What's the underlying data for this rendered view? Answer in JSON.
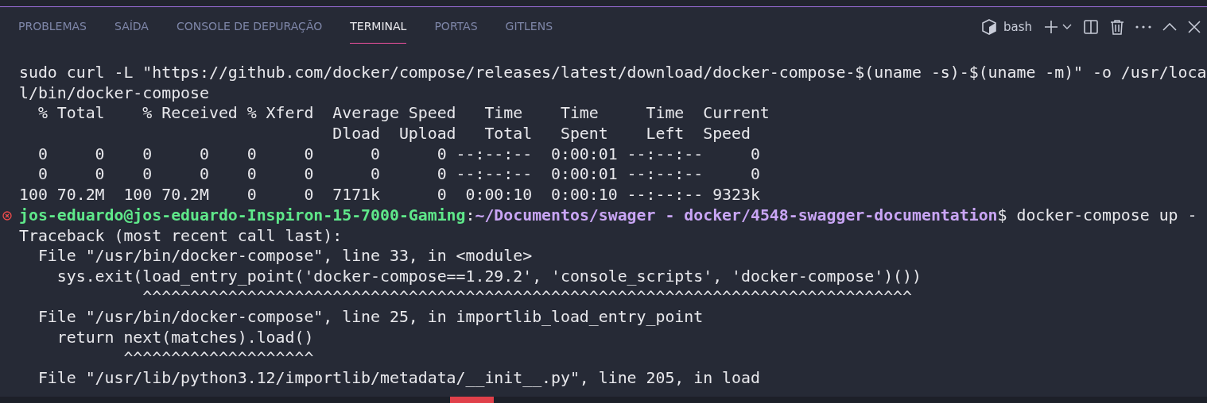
{
  "panel_tabs": [
    {
      "label": "PROBLEMAS",
      "selected": false
    },
    {
      "label": "SAÍDA",
      "selected": false
    },
    {
      "label": "CONSOLE DE DEPURAÇÃO",
      "selected": false
    },
    {
      "label": "TERMINAL",
      "selected": true
    },
    {
      "label": "PORTAS",
      "selected": false
    },
    {
      "label": "GITLENS",
      "selected": false
    }
  ],
  "terminal_profile": "bash",
  "terminal_lines": [
    {
      "kind": "text",
      "text": "sudo curl -L \"https://github.com/docker/compose/releases/latest/download/docker-compose-$(uname -s)-$(uname -m)\" -o /usr/loca"
    },
    {
      "kind": "text",
      "text": "l/bin/docker-compose"
    },
    {
      "kind": "text",
      "text": "  % Total    % Received % Xferd  Average Speed   Time    Time     Time  Current"
    },
    {
      "kind": "text",
      "text": "                                 Dload  Upload   Total   Spent    Left  Speed"
    },
    {
      "kind": "text",
      "text": "  0     0    0     0    0     0      0      0 --:--:--  0:00:01 --:--:--     0"
    },
    {
      "kind": "text",
      "text": "  0     0    0     0    0     0      0      0 --:--:--  0:00:01 --:--:--     0"
    },
    {
      "kind": "text",
      "text": "100 70.2M  100 70.2M    0     0  7171k      0  0:00:10  0:00:10 --:--:-- 9323k"
    },
    {
      "kind": "prompt",
      "user_host": "jos-eduardo@jos-eduardo-Inspiron-15-7000-Gaming",
      "separator": ":",
      "path": "~/Documentos/swager - docker/4548-swagger-documentation",
      "command": "$ docker-compose up -",
      "failed": true
    },
    {
      "kind": "text",
      "text": "Traceback (most recent call last):"
    },
    {
      "kind": "text",
      "text": "  File \"/usr/bin/docker-compose\", line 33, in <module>"
    },
    {
      "kind": "text",
      "text": "    sys.exit(load_entry_point('docker-compose==1.29.2', 'console_scripts', 'docker-compose')())"
    },
    {
      "kind": "text",
      "text": "             ^^^^^^^^^^^^^^^^^^^^^^^^^^^^^^^^^^^^^^^^^^^^^^^^^^^^^^^^^^^^^^^^^^^^^^^^^^^^^^^^^"
    },
    {
      "kind": "text",
      "text": "  File \"/usr/bin/docker-compose\", line 25, in importlib_load_entry_point"
    },
    {
      "kind": "text",
      "text": "    return next(matches).load()"
    },
    {
      "kind": "text",
      "text": "           ^^^^^^^^^^^^^^^^^^^^"
    },
    {
      "kind": "text",
      "text": "  File \"/usr/lib/python3.12/importlib/metadata/__init__.py\", line 205, in load"
    }
  ]
}
